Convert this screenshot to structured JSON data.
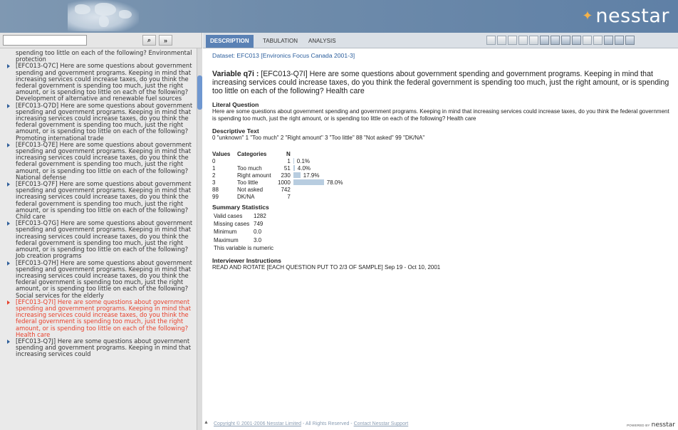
{
  "brand": {
    "logo": "nesstar",
    "logo_icon": "diamond-sparkle-icon"
  },
  "left": {
    "search": {
      "value": "",
      "placeholder": ""
    },
    "items": [
      {
        "text": "spending too little on each of the following? Environmental protection",
        "bullet": false,
        "selected": false
      },
      {
        "text": "[EFC013-Q7C] Here are some questions about government spending and government programs. Keeping in mind that increasing services could increase taxes, do you think the federal government is spending too much, just the right amount, or is spending too little on each of the following? Development of alternative and renewable fuel sources",
        "bullet": true,
        "selected": false
      },
      {
        "text": "[EFC013-Q7D] Here are some questions about government spending and government programs. Keeping in mind that increasing services could increase taxes, do you think the federal government is spending too much, just the right amount, or is spending too little on each of the following? Promoting international trade",
        "bullet": true,
        "selected": false
      },
      {
        "text": "[EFC013-Q7E] Here are some questions about government spending and government programs. Keeping in mind that increasing services could increase taxes, do you think the federal government is spending too much, just the right amount, or is spending too little on each of the following? National defense",
        "bullet": true,
        "selected": false
      },
      {
        "text": "[EFC013-Q7F] Here are some questions about government spending and government programs. Keeping in mind that increasing services could increase taxes, do you think the federal government is spending too much, just the right amount, or is spending too little on each of the following? Child care",
        "bullet": true,
        "selected": false
      },
      {
        "text": "[EFC013-Q7G] Here are some questions about government spending and government programs. Keeping in mind that increasing services could increase taxes, do you think the federal government is spending too much, just the right amount, or is spending too little on each of the following? Job creation programs",
        "bullet": true,
        "selected": false
      },
      {
        "text": "[EFC013-Q7H] Here are some questions about government spending and government programs. Keeping in mind that increasing services could increase taxes, do you think the federal government is spending too much, just the right amount, or is spending too little on each of the following? Social services for the elderly",
        "bullet": true,
        "selected": false
      },
      {
        "text": "[EFC013-Q7I] Here are some questions about government spending and government programs. Keeping in mind that increasing services could increase taxes, do you think the federal government is spending too much, just the right amount, or is spending too little on each of the following? Health care",
        "bullet": true,
        "selected": true
      },
      {
        "text": "[EFC013-Q7J] Here are some questions about government spending and government programs. Keeping in mind that increasing services could",
        "bullet": true,
        "selected": false
      }
    ]
  },
  "tabs": {
    "description": "DESCRIPTION",
    "tabulation": "TABULATION",
    "analysis": "ANALYSIS"
  },
  "main": {
    "dataset": "Dataset: EFC013 [Environics Focus Canada 2001-3]",
    "variable_id": "Variable q7i :",
    "variable_label": " [EFC013-Q7I] Here are some questions about government spending and government programs. Keeping in mind that increasing services could increase taxes, do you think the federal government is spending too much, just the right amount, or is spending too little on each of the following? Health care",
    "literal_heading": "Literal Question",
    "literal_text": "Here are some questions about government spending and government programs. Keeping in mind that increasing services could increase taxes, do you think the federal government is spending too much, just the right amount, or is spending too little on each of the following? Health care",
    "descriptive_heading": "Descriptive Text",
    "descriptive_text": "0 \"unknown\" 1 \"Too much\" 2 \"Right amount\" 3 \"Too little\" 88 \"Not asked\" 99 \"DK/NA\"",
    "values_header": {
      "values": "Values",
      "categories": "Categories",
      "n": "N"
    },
    "summary_heading": "Summary Statistics",
    "summary": [
      {
        "label": "Valid cases",
        "value": "1282"
      },
      {
        "label": "Missing cases",
        "value": "749"
      },
      {
        "label": "Minimum",
        "value": "0.0"
      },
      {
        "label": "Maximum",
        "value": "3.0"
      }
    ],
    "numeric_note": "This variable is numeric",
    "interviewer_heading": "Interviewer Instructions",
    "interviewer_text": "READ AND ROTATE [EACH QUESTION PUT TO 2/3 OF SAMPLE] Sep 19 - Oct 10, 2001"
  },
  "chart_data": {
    "type": "table",
    "rows": [
      {
        "value": "0",
        "category": "",
        "n": 1,
        "pct": "0.1%",
        "frac": 0.001
      },
      {
        "value": "1",
        "category": "Too much",
        "n": 51,
        "pct": "4.0%",
        "frac": 0.04
      },
      {
        "value": "2",
        "category": "Right amount",
        "n": 230,
        "pct": "17.9%",
        "frac": 0.179
      },
      {
        "value": "3",
        "category": "Too little",
        "n": 1000,
        "pct": "78.0%",
        "frac": 0.78
      },
      {
        "value": "88",
        "category": "Not asked",
        "n": 742,
        "pct": "",
        "frac": 0
      },
      {
        "value": "99",
        "category": "DK/NA",
        "n": 7,
        "pct": "",
        "frac": 0
      }
    ]
  },
  "footer": {
    "copyright": "Copyright © 2001-2006 Nesstar Limited",
    "rights": " - All Rights Reserved - ",
    "support": "Contact Nesstar Support",
    "powered": "POWERED BY",
    "powered_name": "nesstar"
  },
  "colors": {
    "tab_active": "#5a81b5",
    "selected_item": "#e8402b",
    "bar": "#b8cde0"
  }
}
